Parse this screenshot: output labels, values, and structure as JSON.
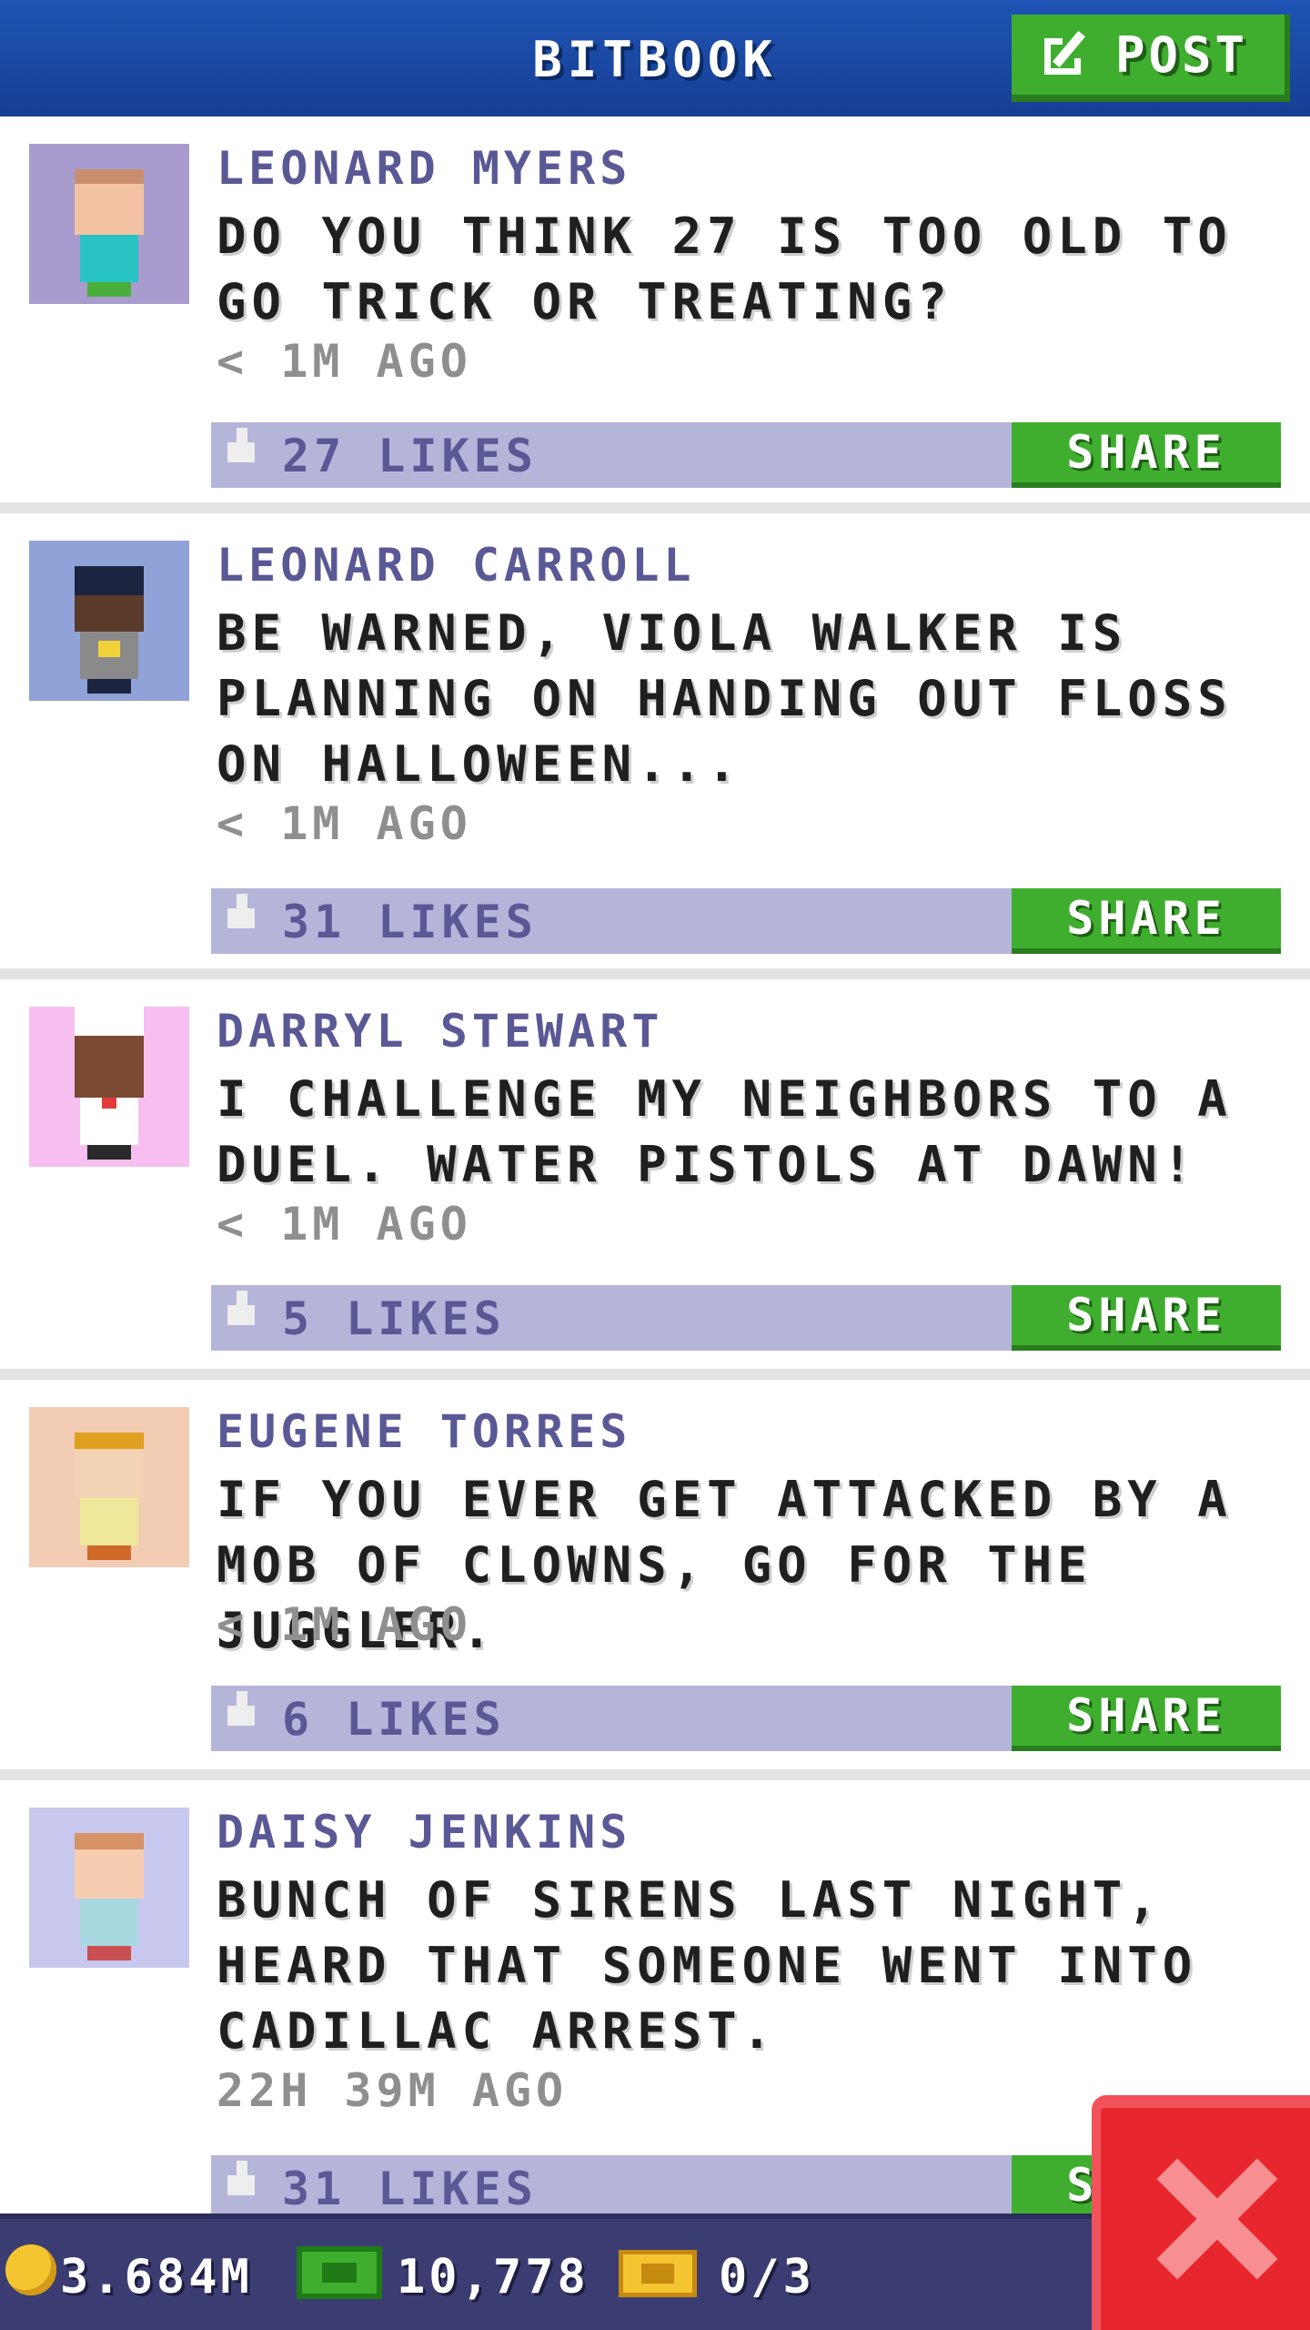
{
  "header": {
    "title": "BITBOOK",
    "post_label": "POST"
  },
  "colors": {
    "header_blue": "#1f54b4",
    "accent_green": "#3fae2f",
    "likes_bar": "#b5b5d9",
    "name_purple": "#5b5896",
    "close_red": "#e8262e"
  },
  "posts": [
    {
      "name": "LEONARD MYERS",
      "text": "DO YOU THINK 27 IS TOO OLD TO GO TRICK OR TREATING?",
      "time": "< 1M AGO",
      "likes": "27 LIKES",
      "share": "SHARE",
      "avatar_bg": "#a89ccf"
    },
    {
      "name": "LEONARD CARROLL",
      "text": "BE WARNED, VIOLA WALKER IS PLANNING ON HANDING OUT FLOSS ON HALLOWEEN...",
      "time": "< 1M AGO",
      "likes": "31 LIKES",
      "share": "SHARE",
      "avatar_bg": "#8fa3d8"
    },
    {
      "name": "DARRYL STEWART",
      "text": "I CHALLENGE MY NEIGHBORS TO A DUEL. WATER PISTOLS AT DAWN!",
      "time": "< 1M AGO",
      "likes": "5 LIKES",
      "share": "SHARE",
      "avatar_bg": "#f7bff0"
    },
    {
      "name": "EUGENE TORRES",
      "text": "IF YOU EVER GET ATTACKED BY A MOB OF CLOWNS, GO FOR THE JUGGLER.",
      "time": "< 1M AGO",
      "likes": "6 LIKES",
      "share": "SHARE",
      "avatar_bg": "#f3ccb4"
    },
    {
      "name": "DAISY JENKINS",
      "text": "BUNCH OF SIRENS LAST NIGHT, HEARD THAT SOMEONE WENT INTO CADILLAC ARREST.",
      "time": "22H 39M AGO",
      "likes": "31 LIKES",
      "share": "SHARE",
      "avatar_bg": "#c8c8ee"
    }
  ],
  "status": {
    "coins": "3.684M",
    "bux": "10,778",
    "tickets": "0/3"
  },
  "icons": {
    "post": "edit-icon",
    "like": "thumbs-up-icon",
    "coin": "coin-icon",
    "bux": "bux-icon",
    "ticket": "vip-ticket-icon",
    "close": "close-icon"
  }
}
